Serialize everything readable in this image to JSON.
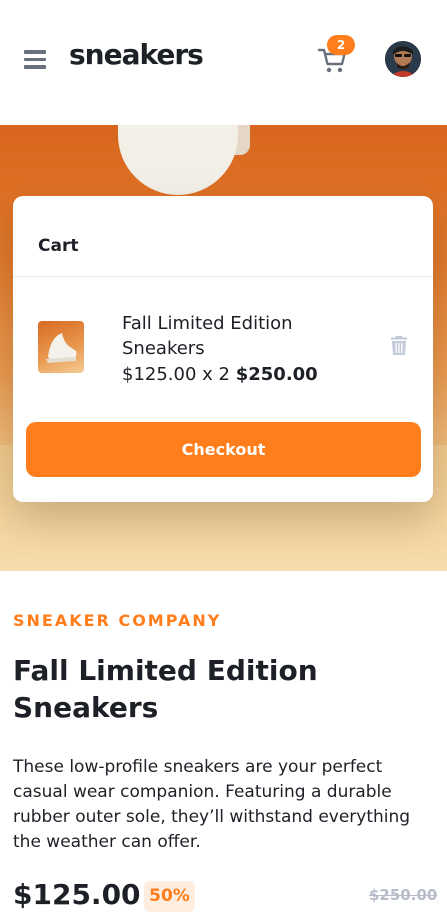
{
  "header": {
    "logo": "sneakers",
    "cart_count": "2",
    "menu_icon": "hamburger-menu-icon",
    "cart_icon": "cart-icon"
  },
  "cart": {
    "title": "Cart",
    "item": {
      "name": "Fall Limited Edition Sneakers",
      "unit_price": "$125.00 x 2",
      "total": "$250.00"
    },
    "checkout_label": "Checkout",
    "delete_icon": "trash-icon"
  },
  "product": {
    "company": "SNEAKER COMPANY",
    "title": "Fall Limited Edition Sneakers",
    "description": "These low-profile sneakers are your perfect casual wear companion. Featuring a durable rubber outer sole, they’ll withstand everything the weather can offer.",
    "price": "$125.00",
    "discount": "50%",
    "original_price": "$250.00"
  },
  "colors": {
    "accent": "#ff7e1b",
    "accent_pale": "#ffede0",
    "text_dark": "#1d2026",
    "text_muted": "#69707d",
    "strike_grey": "#b6bcc8"
  }
}
